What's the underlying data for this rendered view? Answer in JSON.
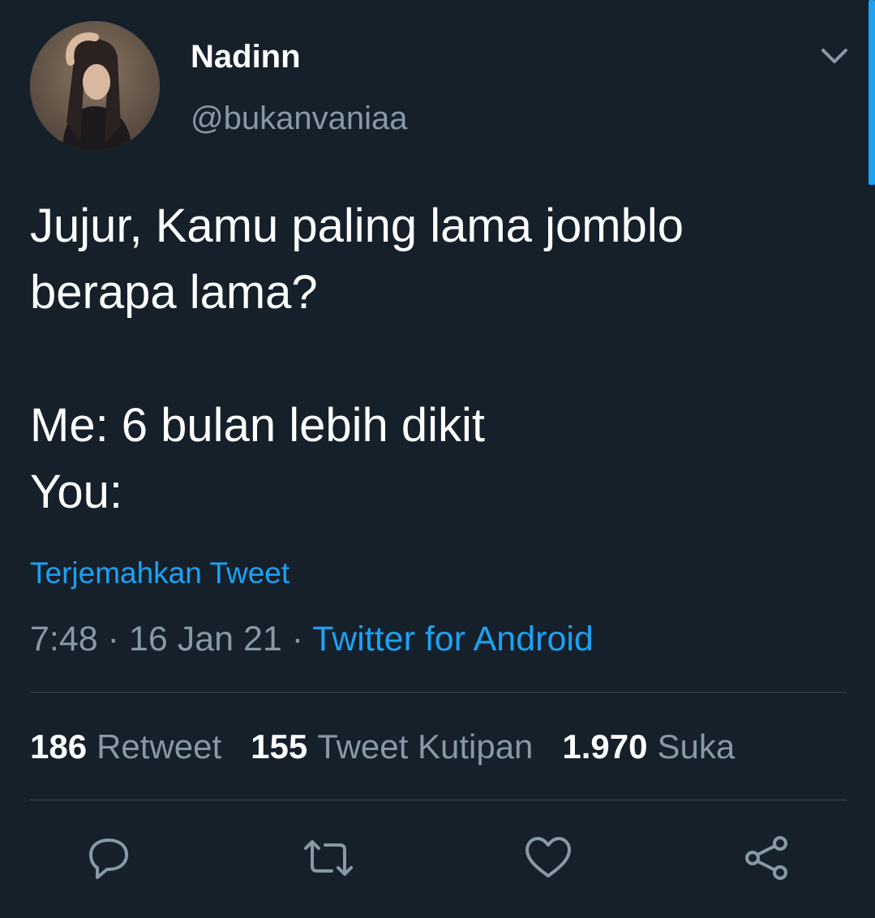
{
  "user": {
    "display_name": "Nadinn",
    "handle": "@bukanvaniaa"
  },
  "tweet": {
    "lines": [
      "Jujur, Kamu paling lama jomblo",
      "berapa lama?",
      "",
      "Me: 6 bulan lebih dikit",
      "You:"
    ],
    "translate_label": "Terjemahkan Tweet",
    "time": "7:48",
    "date": "16 Jan 21",
    "separator": "·",
    "source": "Twitter for Android"
  },
  "stats": {
    "retweets": {
      "count": "186",
      "label": "Retweet"
    },
    "quotes": {
      "count": "155",
      "label": "Tweet Kutipan"
    },
    "likes": {
      "count": "1.970",
      "label": "Suka"
    }
  },
  "actions": {
    "reply": "reply-icon",
    "retweet": "retweet-icon",
    "like": "heart-icon",
    "share": "share-icon"
  },
  "colors": {
    "background": "#15202b",
    "accent": "#1da1f2",
    "secondary_text": "#8899a6",
    "divider": "#38444d"
  }
}
